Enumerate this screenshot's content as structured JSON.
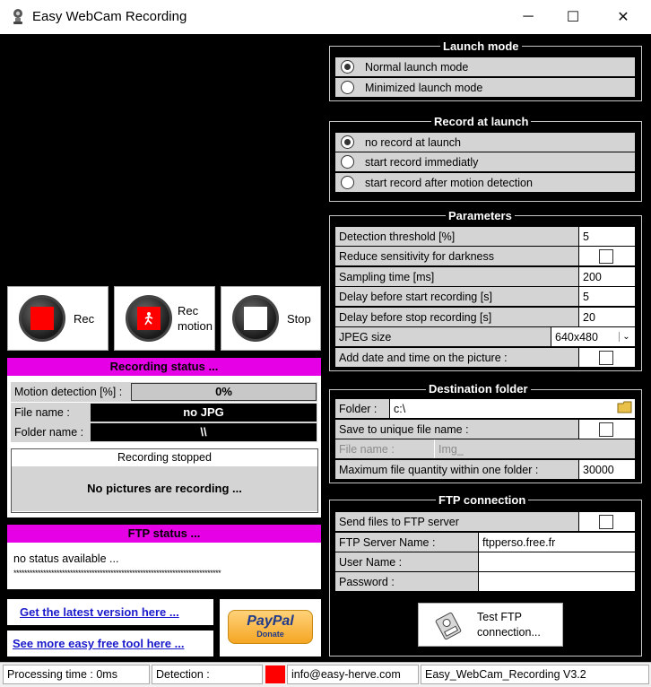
{
  "window": {
    "title": "Easy WebCam Recording",
    "minimize": "─",
    "maximize": "☐",
    "close": "✕"
  },
  "buttons": {
    "rec": "Rec",
    "rec_motion_1": "Rec",
    "rec_motion_2": "motion",
    "stop": "Stop"
  },
  "recording_status": {
    "header": "Recording status ...",
    "motion_label": "Motion detection [%] :",
    "motion_value": "0%",
    "file_label": "File name :",
    "file_value": "no JPG",
    "folder_label": "Folder name :",
    "folder_value": "\\\\",
    "state_title": "Recording stopped",
    "state_message": "No pictures are recording ..."
  },
  "ftp_status": {
    "header": "FTP status ...",
    "message": "no status available ...",
    "stars": "*****************************************************************************"
  },
  "links": {
    "latest": "Get the latest version here ...",
    "more": "See more easy free tool here ..."
  },
  "paypal": {
    "brand": "PayPal",
    "sub": "Donate"
  },
  "launch_mode": {
    "title": "Launch mode",
    "options": [
      "Normal launch mode",
      "Minimized launch mode"
    ],
    "selected": 0
  },
  "record_at_launch": {
    "title": "Record at launch",
    "options": [
      "no record at launch",
      "start record immediatly",
      "start record after motion detection"
    ],
    "selected": 0
  },
  "parameters": {
    "title": "Parameters",
    "detection_threshold_label": "Detection threshold [%]",
    "detection_threshold_value": "5",
    "reduce_sensitivity_label": "Reduce sensitivity for darkness",
    "sampling_time_label": "Sampling time [ms]",
    "sampling_time_value": "200",
    "delay_start_label": "Delay before start recording [s]",
    "delay_start_value": "5",
    "delay_stop_label": "Delay before stop recording [s]",
    "delay_stop_value": "20",
    "jpeg_size_label": "JPEG size",
    "jpeg_size_value": "640x480",
    "add_date_label": "Add date and time on the picture :"
  },
  "destination": {
    "title": "Destination folder",
    "folder_label": "Folder :",
    "folder_value": "c:\\",
    "unique_label": "Save to unique file name :",
    "file_name_label": "File name :",
    "file_name_value": "Img_",
    "max_qty_label": "Maximum file quantity within one folder :",
    "max_qty_value": "30000"
  },
  "ftp": {
    "title": "FTP connection",
    "send_label": "Send files to FTP server",
    "server_label": "FTP Server Name :",
    "server_value": "ftpperso.free.fr",
    "user_label": "User Name :",
    "user_value": "",
    "password_label": "Password :",
    "password_value": "",
    "test_1": "Test FTP",
    "test_2": "connection..."
  },
  "statusbar": {
    "processing": "Processing time : 0ms",
    "detection": "Detection :",
    "email": "info@easy-herve.com",
    "version": "Easy_WebCam_Recording V3.2"
  },
  "colors": {
    "accent_magenta": "#e600e6",
    "record_red": "#ff0000",
    "link_blue": "#1a1acc"
  }
}
